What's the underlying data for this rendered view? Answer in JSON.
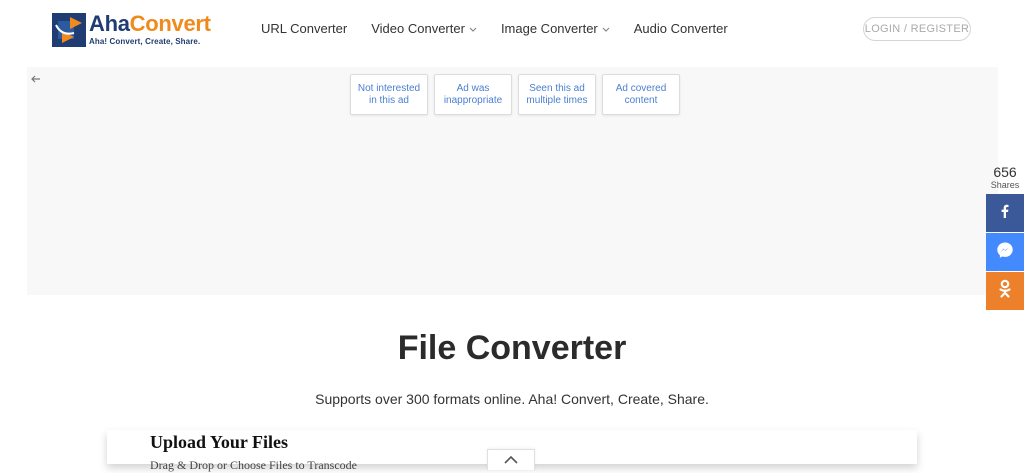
{
  "header": {
    "logo": {
      "name_part1": "Aha",
      "name_part2": "Convert",
      "tagline": "Aha! Convert, Create, Share."
    },
    "nav": [
      {
        "label": "URL Converter",
        "has_dropdown": false
      },
      {
        "label": "Video Converter",
        "has_dropdown": true
      },
      {
        "label": "Image Converter",
        "has_dropdown": true
      },
      {
        "label": "Audio Converter",
        "has_dropdown": false
      }
    ],
    "login_label": "LOGIN / REGISTER"
  },
  "ad": {
    "options": [
      "Not interested\nin this ad",
      "Ad was\ninappropriate",
      "Seen this ad\nmultiple times",
      "Ad covered\ncontent"
    ]
  },
  "share": {
    "count": "656",
    "label": "Shares",
    "buttons": [
      "facebook-icon",
      "messenger-icon",
      "odnoklassniki-icon"
    ]
  },
  "main": {
    "title": "File Converter",
    "subtitle": "Supports over 300 formats online. Aha! Convert, Create, Share.",
    "upload": {
      "title": "Upload Your Files",
      "subtitle": "Drag & Drop or Choose Files to Transcode"
    }
  },
  "colors": {
    "brand_navy": "#1f3c73",
    "brand_orange": "#f08a1c",
    "facebook": "#3b5998",
    "messenger": "#448aff",
    "odnoklassniki": "#ed812b",
    "ad_link": "#4a7fd0"
  }
}
